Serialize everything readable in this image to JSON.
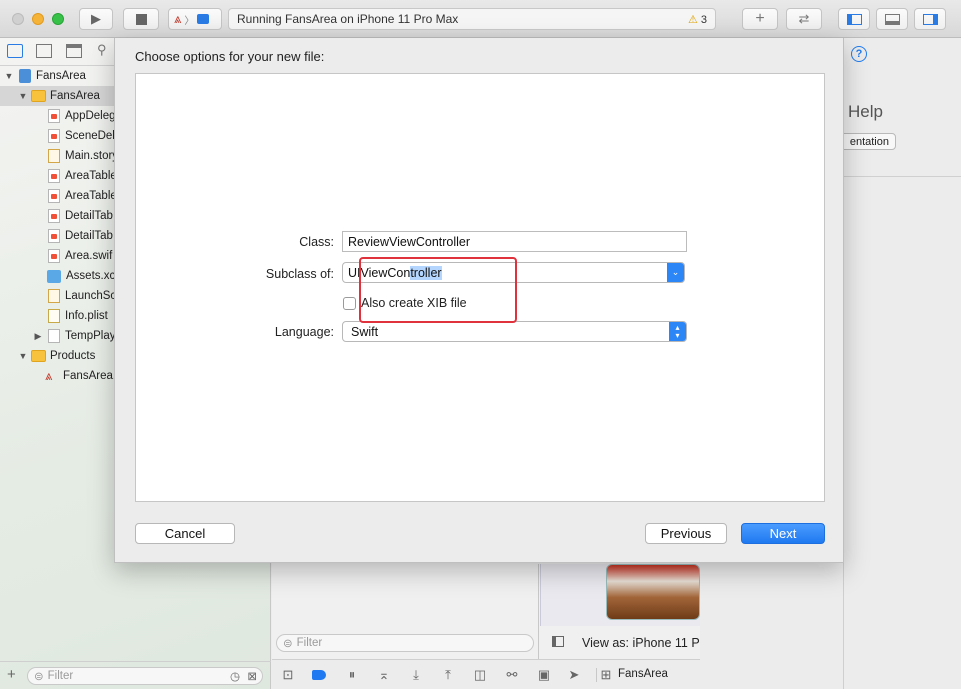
{
  "toolbar": {
    "status_text": "Running FansArea on iPhone 11 Pro Max",
    "warning_count": "3",
    "icons": [
      "run-icon",
      "stop-icon",
      "scheme-icon",
      "add-icon",
      "swap-icon",
      "left-panel-icon",
      "bottom-panel-icon",
      "right-panel-icon"
    ]
  },
  "navigator": {
    "items": [
      {
        "label": "FansArea",
        "type": "project",
        "level": 0,
        "expanded": true
      },
      {
        "label": "FansArea",
        "type": "folder",
        "level": 1,
        "expanded": true,
        "selected": true
      },
      {
        "label": "AppDeleg",
        "type": "swift",
        "level": 2
      },
      {
        "label": "SceneDel",
        "type": "swift",
        "level": 2
      },
      {
        "label": "Main.story",
        "type": "storyboard",
        "level": 2
      },
      {
        "label": "AreaTable",
        "type": "swift",
        "level": 2
      },
      {
        "label": "AreaTable",
        "type": "swift",
        "level": 2
      },
      {
        "label": "DetailTab",
        "type": "swift",
        "level": 2
      },
      {
        "label": "DetailTab",
        "type": "swift",
        "level": 2
      },
      {
        "label": "Area.swif",
        "type": "swift",
        "level": 2
      },
      {
        "label": "Assets.xc",
        "type": "assets",
        "level": 2
      },
      {
        "label": "LaunchSc",
        "type": "storyboard",
        "level": 2
      },
      {
        "label": "Info.plist",
        "type": "plist",
        "level": 2
      },
      {
        "label": "TempPlay",
        "type": "playground",
        "level": 2,
        "collapsed": true
      },
      {
        "label": "Products",
        "type": "folder",
        "level": 1,
        "expanded": true
      },
      {
        "label": "FansArea.",
        "type": "app",
        "level": 2
      }
    ],
    "filter_placeholder": "Filter"
  },
  "editor": {
    "filter_placeholder": "Filter",
    "view_as": "View as: iPhone 11 P"
  },
  "inspector": {
    "help_title": "Help",
    "doc_button": "entation"
  },
  "bottom_bar": {
    "scheme_label": "FansArea"
  },
  "sheet": {
    "title": "Choose options for your new file:",
    "class_label": "Class:",
    "class_value": "ReviewViewController",
    "subclass_label": "Subclass of:",
    "subclass_prefix": "UIViewCon",
    "subclass_selected": "troller",
    "xib_label": "Also create XIB file",
    "xib_checked": false,
    "language_label": "Language:",
    "language_value": "Swift",
    "cancel_label": "Cancel",
    "previous_label": "Previous",
    "next_label": "Next"
  },
  "colors": {
    "accent": "#1f79f0",
    "highlight_box": "#e0323d",
    "selection": "#b4d5fe"
  }
}
